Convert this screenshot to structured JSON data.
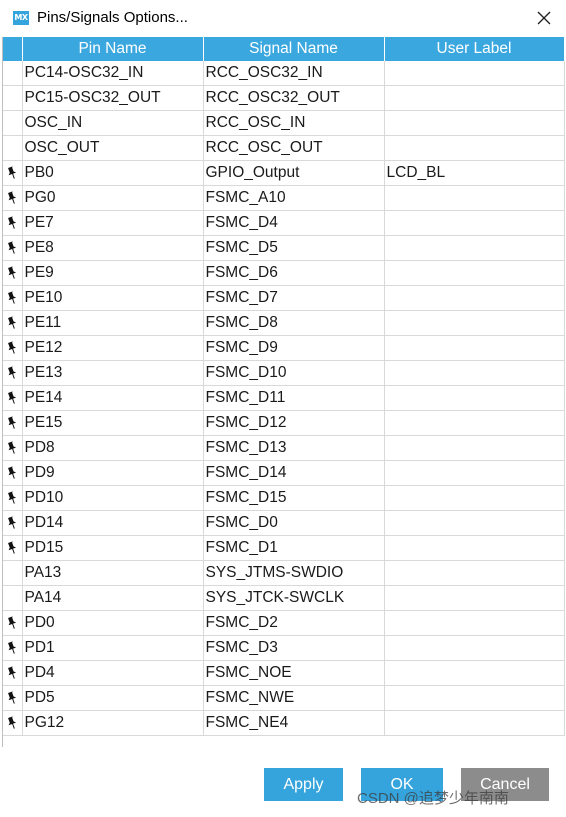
{
  "window": {
    "title": "Pins/Signals Options...",
    "app_icon_text": "MX",
    "accent_color": "#35a4dc",
    "header_color": "#3aa7df",
    "cancel_color": "#8c8c8c"
  },
  "table": {
    "columns": [
      "",
      "Pin Name",
      "Signal Name",
      "User Label"
    ],
    "rows": [
      {
        "pinned": false,
        "pin": "PC14-OSC32_IN",
        "signal": "RCC_OSC32_IN",
        "label": ""
      },
      {
        "pinned": false,
        "pin": "PC15-OSC32_OUT",
        "signal": "RCC_OSC32_OUT",
        "label": ""
      },
      {
        "pinned": false,
        "pin": "OSC_IN",
        "signal": "RCC_OSC_IN",
        "label": ""
      },
      {
        "pinned": false,
        "pin": "OSC_OUT",
        "signal": "RCC_OSC_OUT",
        "label": ""
      },
      {
        "pinned": true,
        "pin": "PB0",
        "signal": "GPIO_Output",
        "label": "LCD_BL"
      },
      {
        "pinned": true,
        "pin": "PG0",
        "signal": "FSMC_A10",
        "label": ""
      },
      {
        "pinned": true,
        "pin": "PE7",
        "signal": "FSMC_D4",
        "label": ""
      },
      {
        "pinned": true,
        "pin": "PE8",
        "signal": "FSMC_D5",
        "label": ""
      },
      {
        "pinned": true,
        "pin": "PE9",
        "signal": "FSMC_D6",
        "label": ""
      },
      {
        "pinned": true,
        "pin": "PE10",
        "signal": "FSMC_D7",
        "label": ""
      },
      {
        "pinned": true,
        "pin": "PE11",
        "signal": "FSMC_D8",
        "label": ""
      },
      {
        "pinned": true,
        "pin": "PE12",
        "signal": "FSMC_D9",
        "label": ""
      },
      {
        "pinned": true,
        "pin": "PE13",
        "signal": "FSMC_D10",
        "label": ""
      },
      {
        "pinned": true,
        "pin": "PE14",
        "signal": "FSMC_D11",
        "label": ""
      },
      {
        "pinned": true,
        "pin": "PE15",
        "signal": "FSMC_D12",
        "label": ""
      },
      {
        "pinned": true,
        "pin": "PD8",
        "signal": "FSMC_D13",
        "label": ""
      },
      {
        "pinned": true,
        "pin": "PD9",
        "signal": "FSMC_D14",
        "label": ""
      },
      {
        "pinned": true,
        "pin": "PD10",
        "signal": "FSMC_D15",
        "label": ""
      },
      {
        "pinned": true,
        "pin": "PD14",
        "signal": "FSMC_D0",
        "label": ""
      },
      {
        "pinned": true,
        "pin": "PD15",
        "signal": "FSMC_D1",
        "label": ""
      },
      {
        "pinned": false,
        "pin": "PA13",
        "signal": "SYS_JTMS-SWDIO",
        "label": ""
      },
      {
        "pinned": false,
        "pin": "PA14",
        "signal": "SYS_JTCK-SWCLK",
        "label": ""
      },
      {
        "pinned": true,
        "pin": "PD0",
        "signal": "FSMC_D2",
        "label": ""
      },
      {
        "pinned": true,
        "pin": "PD1",
        "signal": "FSMC_D3",
        "label": ""
      },
      {
        "pinned": true,
        "pin": "PD4",
        "signal": "FSMC_NOE",
        "label": ""
      },
      {
        "pinned": true,
        "pin": "PD5",
        "signal": "FSMC_NWE",
        "label": ""
      },
      {
        "pinned": true,
        "pin": "PG12",
        "signal": "FSMC_NE4",
        "label": ""
      }
    ],
    "pin_icon": "pushpin-icon"
  },
  "buttons": {
    "apply": "Apply",
    "ok": "OK",
    "cancel": "Cancel"
  },
  "watermark": "CSDN @追梦少年南南"
}
